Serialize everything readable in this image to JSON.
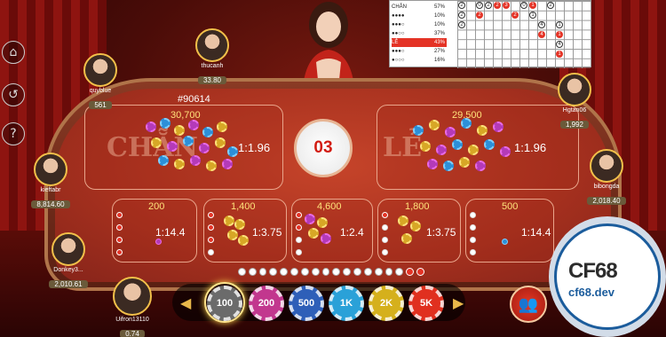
{
  "game_id": "#90614",
  "timer": "03",
  "bets": {
    "chan": {
      "label": "CHẴN",
      "amount": "30,700",
      "odds": "1:1.96"
    },
    "le": {
      "label": "LẺ",
      "amount": "29,500",
      "odds": "1:1.96"
    },
    "sub": [
      {
        "amount": "200",
        "odds": "1:14.4"
      },
      {
        "amount": "1,400",
        "odds": "1:3.75"
      },
      {
        "amount": "4,600",
        "odds": "1:2.4"
      },
      {
        "amount": "1,800",
        "odds": "1:3.75"
      },
      {
        "amount": "500",
        "odds": "1:14.4"
      }
    ]
  },
  "players": [
    {
      "name": "quyblue",
      "balance": "561"
    },
    {
      "name": "thucanh",
      "balance": "33.80"
    },
    {
      "name": "kieftabr",
      "balance": "8,814.60"
    },
    {
      "name": "Donkey3...",
      "balance": "2,010.61"
    },
    {
      "name": "Hgtan06",
      "balance": "1,992"
    },
    {
      "name": "bibongda",
      "balance": "2,018.40"
    },
    {
      "name": "Uifron13110",
      "balance": "0.74"
    }
  ],
  "stats": {
    "chan_label": "CHẴN",
    "chan_pct": "57%",
    "le_label": "LẺ",
    "le_pct": "43%",
    "rows": [
      "10%",
      "10%",
      "37%",
      "27%",
      "16%"
    ],
    "grid_numbers": [
      "2",
      "0",
      "2",
      "2",
      "3",
      "0",
      "1",
      "2",
      "2",
      "2",
      "2",
      "1",
      "2",
      "4",
      "1",
      "4",
      "1",
      "4",
      "1"
    ]
  },
  "chips": [
    "100",
    "200",
    "500",
    "1K",
    "2K",
    "5K"
  ],
  "logo": {
    "mark": "CF68",
    "domain": "cf68.dev"
  },
  "side_icons": [
    "home-icon",
    "history-icon",
    "help-icon"
  ],
  "colors": {
    "red": "#e43326",
    "gold": "#f2c04a",
    "felt": "#a5301e"
  }
}
